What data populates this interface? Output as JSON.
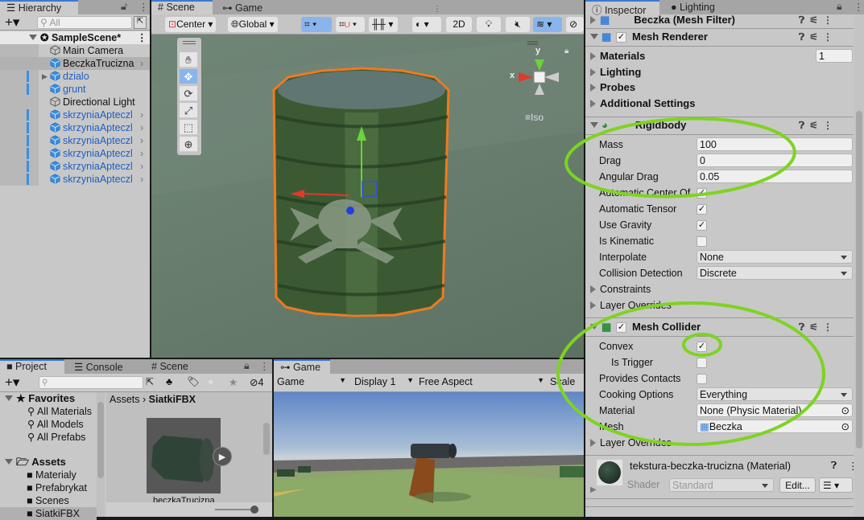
{
  "hierarchy": {
    "tab": "Hierarchy",
    "search_placeholder": "All",
    "scene": "SampleScene*",
    "items": [
      {
        "label": "Main Camera",
        "type": "gameobject",
        "prefab": false
      },
      {
        "label": "BeczkaTrucizna",
        "type": "prefab",
        "prefab": false,
        "selected": true
      },
      {
        "label": "dzialo",
        "type": "prefab",
        "prefab": true,
        "expandable": true
      },
      {
        "label": "grunt",
        "type": "prefab",
        "prefab": true
      },
      {
        "label": "Directional Light",
        "type": "gameobject",
        "prefab": false
      },
      {
        "label": "skrzyniaApteczl",
        "type": "prefab",
        "prefab": true
      },
      {
        "label": "skrzyniaApteczl",
        "type": "prefab",
        "prefab": true
      },
      {
        "label": "skrzyniaApteczl",
        "type": "prefab",
        "prefab": true
      },
      {
        "label": "skrzyniaApteczl",
        "type": "prefab",
        "prefab": true
      },
      {
        "label": "skrzyniaApteczl",
        "type": "prefab",
        "prefab": true
      },
      {
        "label": "skrzyniaApteczl",
        "type": "prefab",
        "prefab": true
      }
    ]
  },
  "scene": {
    "tabs": [
      "Scene",
      "Game"
    ],
    "pivot": "Center",
    "space": "Global",
    "mode_2d": "2D",
    "gizmo": {
      "x": "x",
      "y": "y",
      "projection": "Iso"
    },
    "colors": {
      "selection_outline": "#f07a1e",
      "axis_x": "#e03a2a",
      "axis_y": "#6cd33a",
      "axis_z": "#1f3fe0"
    }
  },
  "project": {
    "tabs": [
      "Project",
      "Console",
      "Scene"
    ],
    "hidden_count": "4",
    "favorites": {
      "label": "Favorites",
      "items": [
        "All Materials",
        "All Models",
        "All Prefabs"
      ]
    },
    "assets": {
      "label": "Assets",
      "items": [
        "Materialy",
        "Prefabrykat",
        "Scenes",
        "SiatkiFBX"
      ]
    },
    "breadcrumb": [
      "Assets",
      "SiatkiFBX"
    ],
    "asset_name": "beczkaTrucizna"
  },
  "game": {
    "tab": "Game",
    "mode": "Game",
    "display": "Display 1",
    "aspect": "Free Aspect",
    "scale": "Scale"
  },
  "inspector": {
    "tabs": [
      "Inspector",
      "Lighting"
    ],
    "mesh_filter": "Beczka (Mesh Filter)",
    "mesh_renderer": {
      "title": "Mesh Renderer",
      "enabled": true,
      "materials_label": "Materials",
      "materials_count": "1",
      "folds": [
        "Lighting",
        "Probes",
        "Additional Settings"
      ]
    },
    "rigidbody": {
      "title": "Rigidbody",
      "mass_label": "Mass",
      "mass": "100",
      "drag_label": "Drag",
      "drag": "0",
      "angular_drag_label": "Angular Drag",
      "angular_drag": "0.05",
      "checks": [
        {
          "label": "Automatic Center Of",
          "checked": true
        },
        {
          "label": "Automatic Tensor",
          "checked": true
        },
        {
          "label": "Use Gravity",
          "checked": true
        },
        {
          "label": "Is Kinematic",
          "checked": false
        }
      ],
      "interpolate_label": "Interpolate",
      "interpolate": "None",
      "collision_label": "Collision Detection",
      "collision": "Discrete",
      "constraints": "Constraints",
      "layer_overrides": "Layer Overrides"
    },
    "mesh_collider": {
      "title": "Mesh Collider",
      "enabled": true,
      "checks": [
        {
          "label": "Convex",
          "checked": true
        },
        {
          "label": "Is Trigger",
          "checked": false
        },
        {
          "label": "Provides Contacts",
          "checked": false
        }
      ],
      "cooking_label": "Cooking Options",
      "cooking": "Everything",
      "material_label": "Material",
      "material": "None (Physic Material)",
      "mesh_label": "Mesh",
      "mesh": "Beczka",
      "layer_overrides": "Layer Overrides"
    },
    "material": {
      "title": "tekstura-beczka-trucizna (Material)",
      "shader_label": "Shader",
      "shader": "Standard",
      "edit": "Edit..."
    },
    "annotation_color": "#7ed321"
  }
}
